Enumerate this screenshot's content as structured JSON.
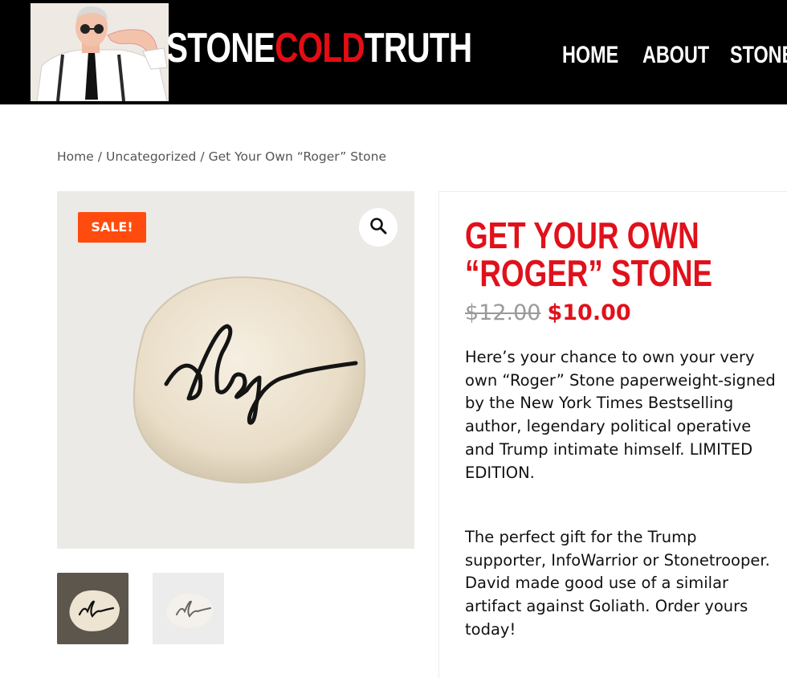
{
  "header": {
    "logo": {
      "part1": "STONE",
      "part2": "COLD",
      "part3": "TRUTH"
    },
    "nav": [
      {
        "label": "HOME"
      },
      {
        "label": "ABOUT"
      },
      {
        "label": "STONEZ"
      }
    ]
  },
  "breadcrumb": {
    "items": [
      "Home",
      "Uncategorized",
      "Get Your Own “Roger” Stone"
    ],
    "separator": "/"
  },
  "gallery": {
    "sale_badge": "SALE!",
    "zoom_icon": "magnifier-icon",
    "thumbnails": 2
  },
  "product": {
    "title_line1": "GET YOUR OWN",
    "title_line2": "“ROGER” STONE",
    "old_price": "$12.00",
    "new_price": "$10.00",
    "description1": "Here’s your chance to own your very own “Roger” Stone paperweight-signed by the New York Times Bestselling author, legendary political operative and Trump intimate himself. LIMITED EDITION.",
    "description2": "The perfect gift for the Trump supporter, InfoWarrior or Stonetrooper. David made good use of a similar artifact against Goliath. Order yours today!"
  },
  "colors": {
    "accent_red": "#e0111b",
    "sale_orange": "#ff4b0d",
    "header_bg": "#000000"
  }
}
